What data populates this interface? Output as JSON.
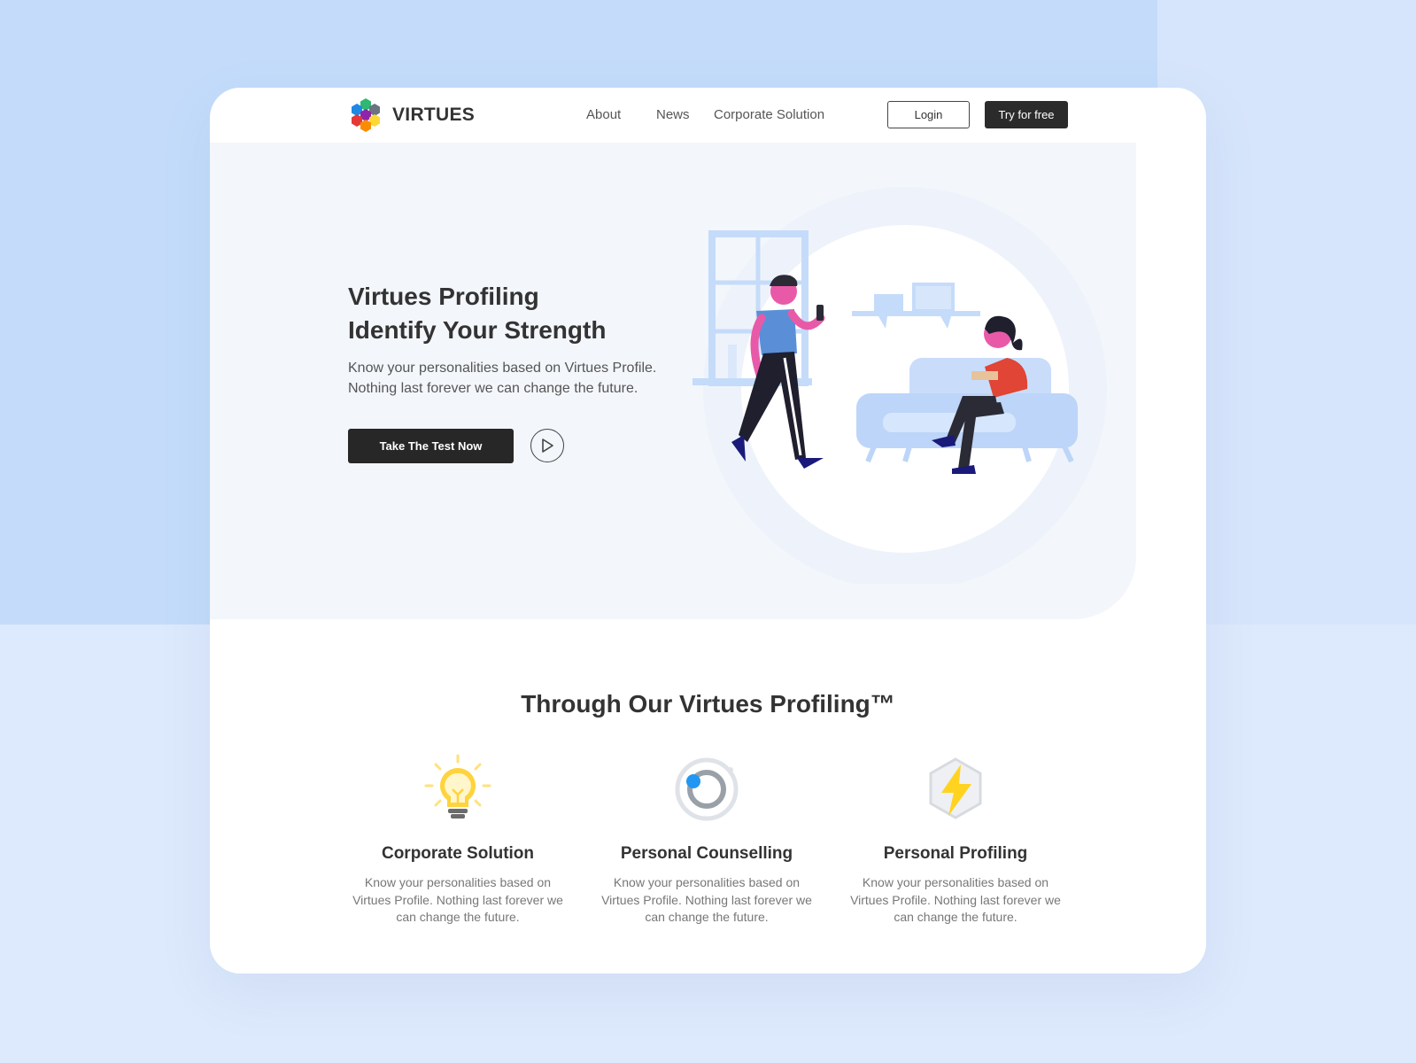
{
  "brand": {
    "name": "VIRTUES",
    "logo_icon": "hexagon-cluster-logo"
  },
  "nav": {
    "links": [
      "About",
      "News",
      "Corporate Solution"
    ],
    "login_label": "Login",
    "try_label": "Try for free"
  },
  "hero": {
    "title_line1": "Virtues Profiling",
    "title_line2": "Identify Your Strength",
    "subtitle_line1": "Know your personalities based on Virtues Profile.",
    "subtitle_line2": "Nothing last forever we can change the future.",
    "cta_label": "Take The Test Now",
    "play_icon": "play-icon"
  },
  "features": {
    "title": "Through Our Virtues Profiling™",
    "items": [
      {
        "icon": "lightbulb-icon",
        "title": "Corporate Solution",
        "desc": "Know your personalities based on Virtues Profile. Nothing last forever we can change the future."
      },
      {
        "icon": "ring-icon",
        "title": "Personal Counselling",
        "desc": "Know your personalities based on Virtues Profile. Nothing last forever we can change the future."
      },
      {
        "icon": "lightning-bolt-icon",
        "title": "Personal Profiling",
        "desc": "Know your personalities based on Virtues Profile. Nothing last forever we can change the future."
      }
    ]
  },
  "colors": {
    "page_bg": "#dde9fc",
    "accent_block": "#c4dcfa",
    "hero_bg": "#f3f6fb",
    "dark_button": "#2b2b2b",
    "bulb_yellow": "#ffd33d",
    "ring_blue": "#2196f3"
  }
}
